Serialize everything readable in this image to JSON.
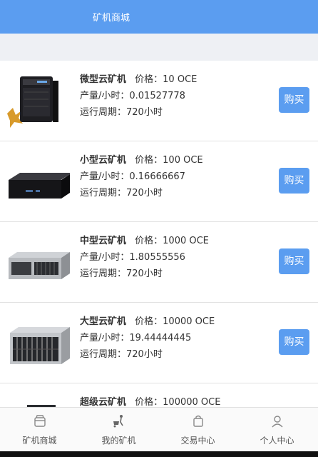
{
  "header": {
    "title": "矿机商城"
  },
  "products": [
    {
      "name": "微型云矿机",
      "price": "价格：10 OCE",
      "output": "产量/小时：0.01527778",
      "period": "运行周期：720小时",
      "buy": "购买",
      "icon": "micro-server-tower-icon"
    },
    {
      "name": "小型云矿机",
      "price": "价格：100 OCE",
      "output": "产量/小时：0.16666667",
      "period": "运行周期：720小时",
      "buy": "购买",
      "icon": "small-server-box-icon"
    },
    {
      "name": "中型云矿机",
      "price": "价格：1000 OCE",
      "output": "产量/小时：1.80555556",
      "period": "运行周期：720小时",
      "buy": "购买",
      "icon": "rack-server-icon"
    },
    {
      "name": "大型云矿机",
      "price": "价格：10000 OCE",
      "output": "产量/小时：19.44444445",
      "period": "运行周期：720小时",
      "buy": "购买",
      "icon": "storage-server-icon"
    },
    {
      "name": "超级云矿机",
      "price": "价格：100000 OCE",
      "output": "",
      "period": "",
      "buy": "",
      "icon": "super-server-tower-icon"
    }
  ],
  "tabbar": {
    "items": [
      {
        "label": "矿机商城",
        "icon": "store-icon"
      },
      {
        "label": "我的矿机",
        "icon": "miner-cart-icon"
      },
      {
        "label": "交易中心",
        "icon": "shopping-bag-icon"
      },
      {
        "label": "个人中心",
        "icon": "person-icon"
      }
    ]
  },
  "colors": {
    "accent": "#5b9df0",
    "background": "#eef0f4"
  }
}
